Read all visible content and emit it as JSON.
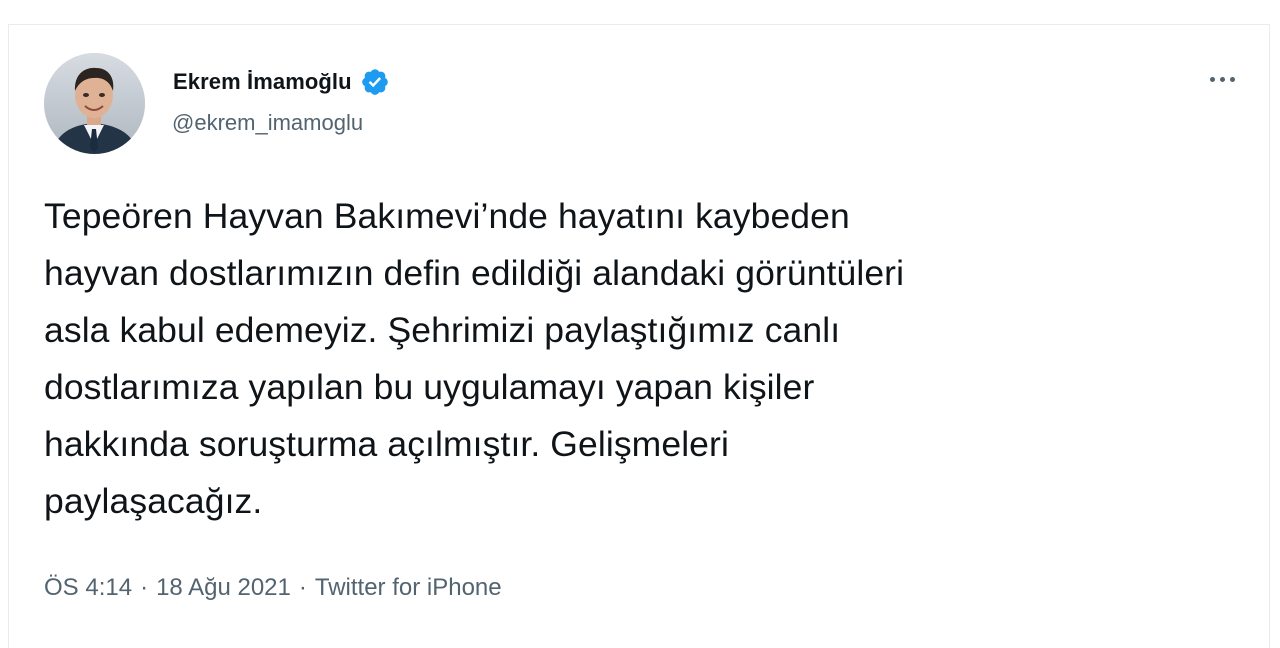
{
  "author": {
    "display_name": "Ekrem İmamoğlu",
    "handle": "@ekrem_imamoglu",
    "verified": true,
    "avatar_icon": "profile-photo"
  },
  "tweet": {
    "text": "Tepeören Hayvan Bakımevi’nde hayatını kaybeden\nhayvan dostlarımızın defin edildiği alandaki görüntüleri\nasla kabul edemeyiz. Şehrimizi paylaştığımız canlı\ndostlarımıza yapılan bu uygulamayı yapan kişiler\nhakkında soruşturma açılmıştır. Gelişmeleri\npaylaşacağız."
  },
  "meta": {
    "time": "ÖS 4:14",
    "separator": "·",
    "date": "18 Ağu 2021",
    "source": "Twitter for iPhone"
  },
  "icons": {
    "verified": "verified-badge-icon",
    "more": "more-options-icon"
  },
  "colors": {
    "text_primary": "#0f1419",
    "text_secondary": "#536471",
    "verified_blue": "#1d9bf0",
    "border": "#e6ecf0"
  }
}
